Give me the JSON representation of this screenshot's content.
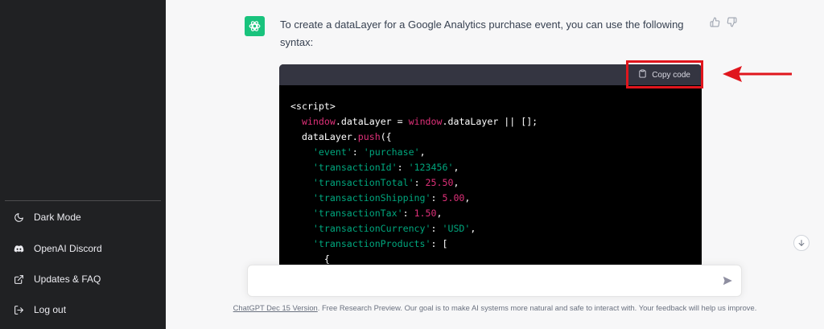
{
  "sidebar": {
    "items": [
      {
        "label": "Dark Mode",
        "icon": "moon-icon"
      },
      {
        "label": "OpenAI Discord",
        "icon": "discord-icon"
      },
      {
        "label": "Updates & FAQ",
        "icon": "external-link-icon"
      },
      {
        "label": "Log out",
        "icon": "logout-icon"
      }
    ]
  },
  "message": {
    "text": "To create a dataLayer for a Google Analytics purchase event, you can use the following syntax:"
  },
  "code_block": {
    "copy_label": "Copy code",
    "lines": [
      "<script>",
      "  window.dataLayer = window.dataLayer || [];",
      "  dataLayer.push({",
      "    'event': 'purchase',",
      "    'transactionId': '123456',",
      "    'transactionTotal': 25.50,",
      "    'transactionShipping': 5.00,",
      "    'transactionTax': 1.50,",
      "    'transactionCurrency': 'USD',",
      "    'transactionProducts': [",
      "      {"
    ]
  },
  "input": {
    "value": "",
    "placeholder": ""
  },
  "footer": {
    "version_link": "ChatGPT Dec 15 Version",
    "text": ". Free Research Preview. Our goal is to make AI systems more natural and safe to interact with. Your feedback will help us improve."
  },
  "colors": {
    "sidebar_bg": "#202123",
    "avatar_bg": "#19c37d",
    "code_bg": "#000000",
    "code_header_bg": "#343541",
    "annotation_red": "#e0161d",
    "string_color": "#00a67d",
    "number_color": "#df3079"
  }
}
